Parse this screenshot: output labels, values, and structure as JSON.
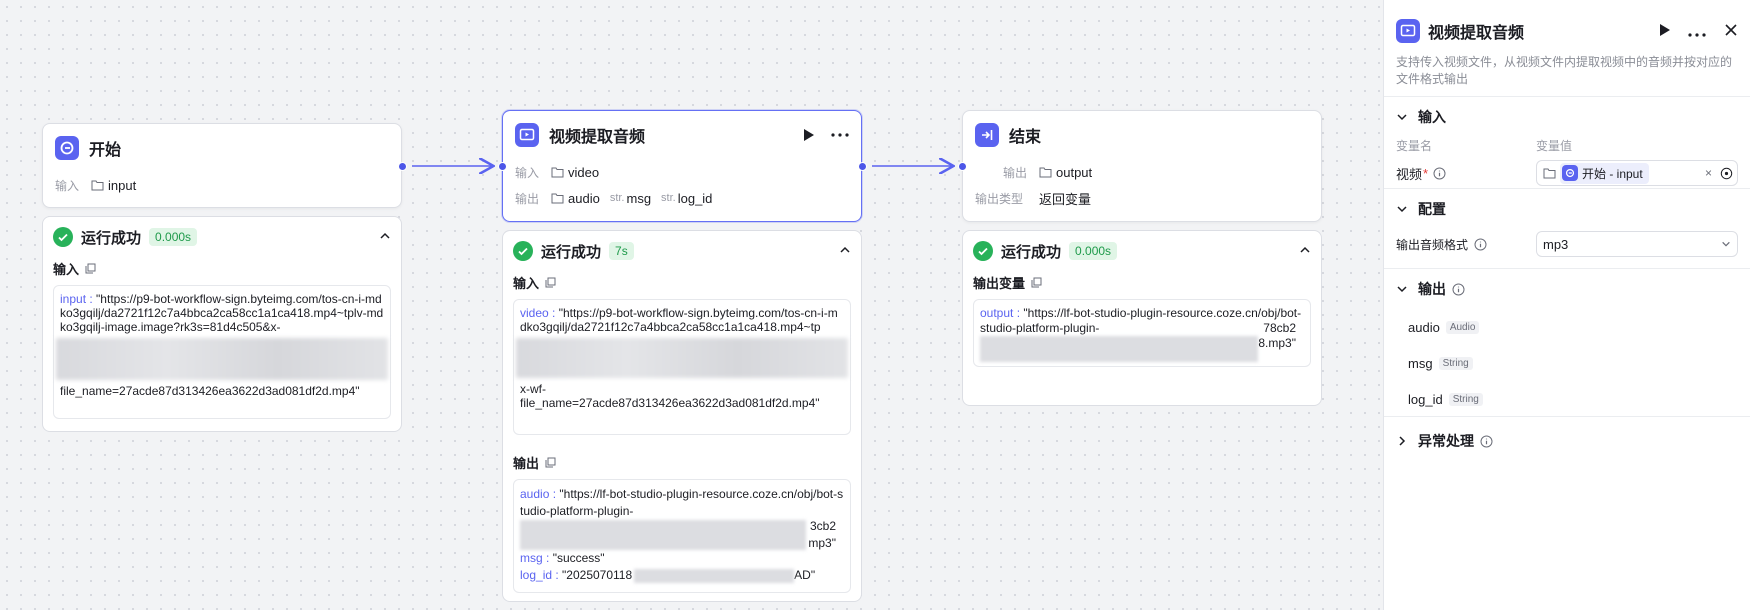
{
  "colors": {
    "accent": "#5a63f0",
    "success": "#28b25a",
    "edge": "#5a63f0"
  },
  "nodes": {
    "start": {
      "title": "开始",
      "input_label": "输入",
      "input_var": "input",
      "result": {
        "status": "运行成功",
        "time": "0.000s",
        "input_title": "输入",
        "content_key": "input",
        "content_line1": "\"https://p9-bot-workflow-sign.byteimg.com/tos-cn-i-mdko3gqilj/da2721f12c7a4bbca2ca58cc1a1ca418.mp4~tplv-mdko3gqilj-image.image?rk3s=81d4c505&x-",
        "content_line2": "file_name=27acde87d313426ea3622d3ad081df2d.mp4\""
      }
    },
    "video": {
      "title": "视频提取音频",
      "input_label": "输入",
      "output_label": "输出",
      "input_var": "video",
      "outputs": [
        {
          "type": "",
          "name": "audio"
        },
        {
          "type": "str.",
          "name": "msg"
        },
        {
          "type": "str.",
          "name": "log_id"
        }
      ],
      "result": {
        "status": "运行成功",
        "time": "7s",
        "input_title": "输入",
        "input_key": "video",
        "input_line1": "\"https://p9-bot-workflow-sign.byteimg.com/tos-cn-i-mdko3gqilj/da2721f12c7a4bbca2ca58cc1a1ca418.mp4~tp",
        "input_line2": "x-wf-",
        "input_line3": "file_name=27acde87d313426ea3622d3ad081df2d.mp4\"",
        "output_title": "输出",
        "audio_key": "audio",
        "audio_val1": "\"https://lf-bot-studio-plugin-resource.coze.cn/obj/bot-studio-platform-plugin-",
        "audio_tail1": "3cb2",
        "audio_tail2": "mp3\"",
        "msg_key": "msg",
        "msg_val": "\"success\"",
        "log_key": "log_id",
        "log_val": "\"2025070118",
        "log_tail": "AD\""
      }
    },
    "end": {
      "title": "结束",
      "output_label": "输出",
      "output_var": "output",
      "type_label": "输出类型",
      "type_value": "返回变量",
      "result": {
        "status": "运行成功",
        "time": "0.000s",
        "title": "输出变量",
        "key": "output",
        "line1": "\"https://lf-bot-studio-plugin-resource.coze.cn/obj/bot-studio-platform-plugin-",
        "tail1": "78cb2",
        "tail2": "8.mp3\""
      }
    }
  },
  "panel": {
    "title": "视频提取音频",
    "description": "支持传入视频文件，从视频文件内提取视频中的音频并按对应的文件格式输出",
    "input_section": "输入",
    "col_name": "变量名",
    "col_value": "变量值",
    "video_field": "视频",
    "required_mark": "*",
    "ref_value": "开始 - input",
    "clear_mark": "×",
    "config_section": "配置",
    "format_label": "输出音频格式",
    "format_value": "mp3",
    "output_section": "输出",
    "outputs": [
      {
        "name": "audio",
        "type": "Audio"
      },
      {
        "name": "msg",
        "type": "String"
      },
      {
        "name": "log_id",
        "type": "String"
      }
    ],
    "error_section": "异常处理"
  }
}
